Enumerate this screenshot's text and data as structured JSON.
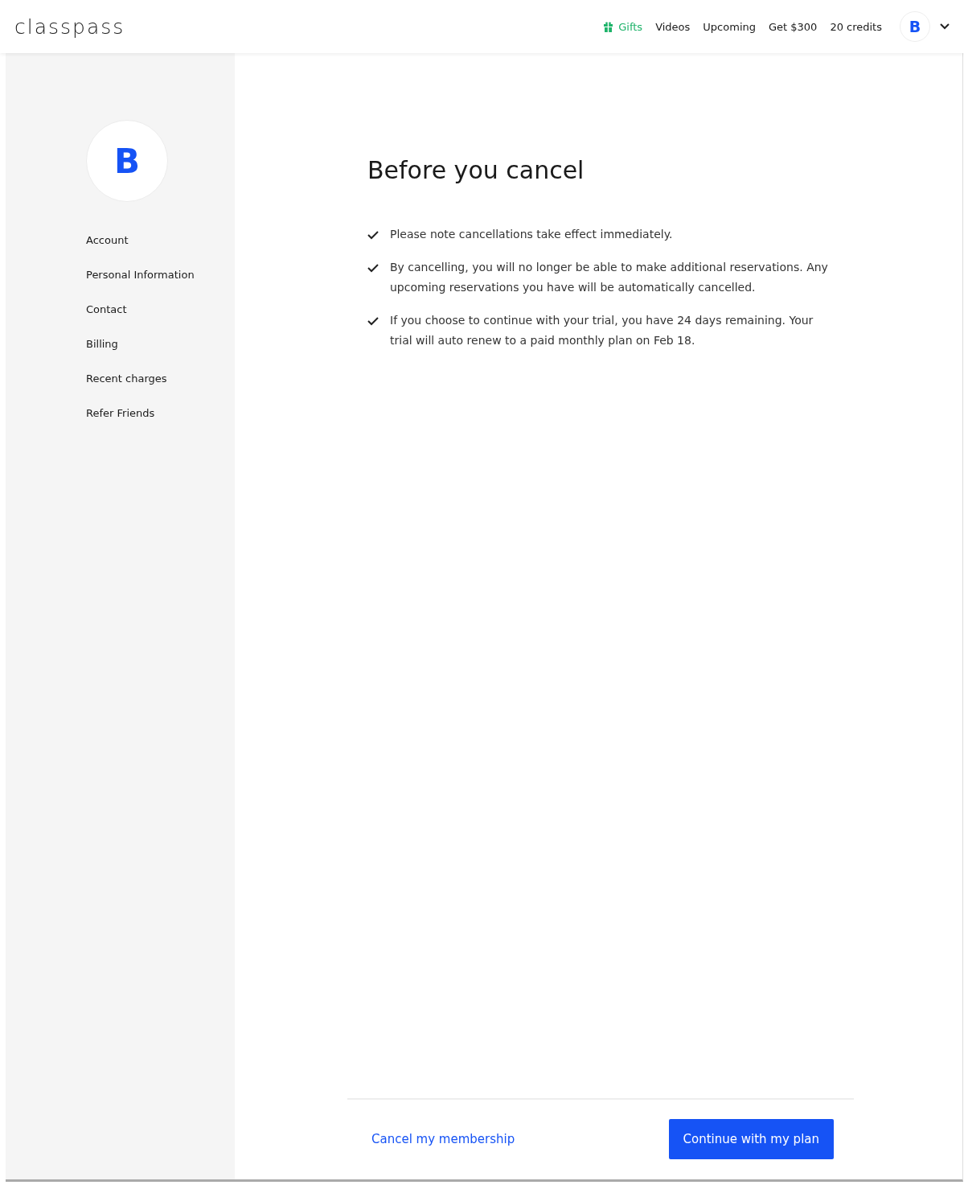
{
  "header": {
    "logo": "classpass",
    "nav": [
      {
        "kind": "promo",
        "label": "Gifts"
      },
      {
        "kind": "link",
        "label": "Videos"
      },
      {
        "kind": "link",
        "label": "Upcoming"
      },
      {
        "kind": "link",
        "label": "Get $300"
      },
      {
        "kind": "link",
        "label": "20 credits"
      }
    ],
    "avatar": "B"
  },
  "sidebar": {
    "avatar": "B",
    "items": [
      "Account",
      "Personal Information",
      "Contact",
      "Billing",
      "Recent charges",
      "Refer Friends"
    ]
  },
  "main": {
    "title": "Before you cancel",
    "notes": [
      "Please note cancellations take effect immediately.",
      "By cancelling, you will no longer be able to make additional reservations. Any upcoming reservations you have will be automatically cancelled.",
      "If you choose to continue with your trial, you have 24 days remaining. Your trial will auto renew to a paid monthly plan on Feb 18."
    ],
    "cancel_link": "Cancel my membership",
    "continue_button": "Continue with my plan"
  }
}
